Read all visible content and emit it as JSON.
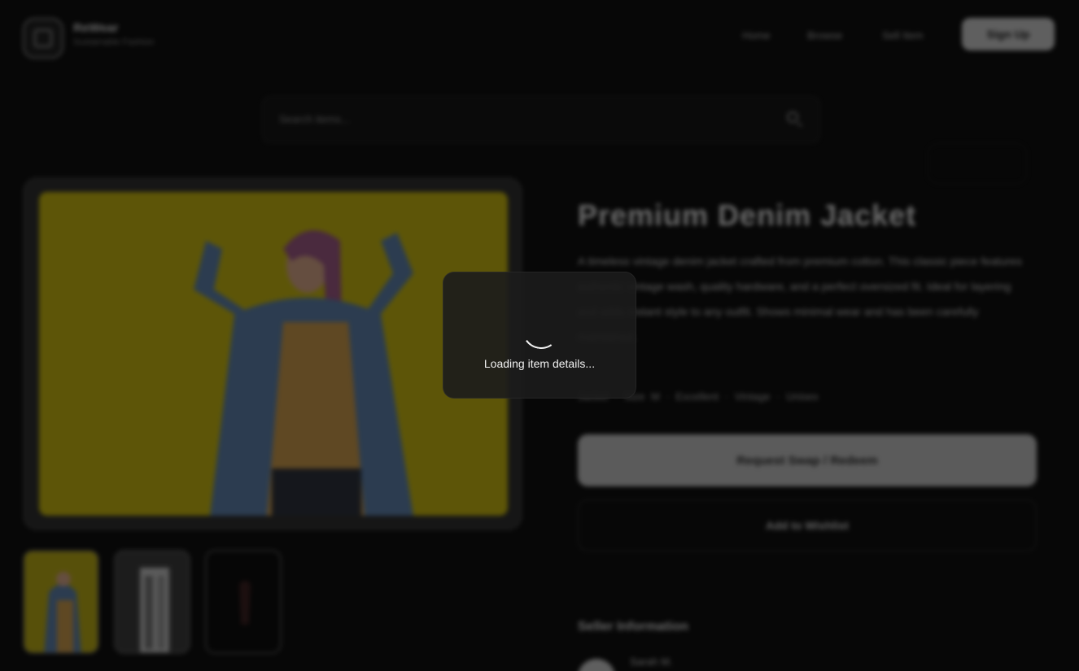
{
  "brand": {
    "name": "ReWear",
    "tagline": "Sustainable Fashion"
  },
  "nav": {
    "links": [
      "Home",
      "Browse",
      "Sell Item"
    ],
    "signup_label": "Sign Up"
  },
  "search": {
    "placeholder": "Search items..."
  },
  "item": {
    "title": "Premium Denim Jacket",
    "description": "A timeless vintage denim jacket crafted from premium cotton. This classic piece features authentic vintage wash, quality hardware, and a perfect oversized fit. Ideal for layering and adds instant style to any outfit. Shows minimal wear and has been carefully maintained.",
    "tags": "Jacket · Size M · Excellent · Vintage · Unisex",
    "primary_action": "Request Swap / Redeem",
    "secondary_action": "Add to Wishlist"
  },
  "seller": {
    "heading": "Seller Information",
    "name": "Sarah M."
  },
  "overlay": {
    "loading_text": "Loading item details..."
  },
  "colors": {
    "accent_yellow": "#d4c20a",
    "background": "#070707",
    "spinner": "#f2f2f2"
  }
}
